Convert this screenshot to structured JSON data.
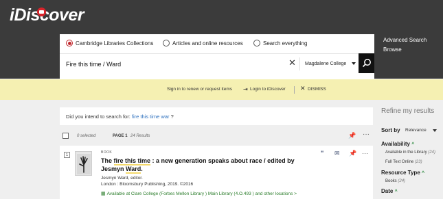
{
  "header": {
    "logo": "iDiscover",
    "links": [
      "Advanced Search",
      "Browse"
    ]
  },
  "search": {
    "scopes": [
      {
        "label": "Cambridge Libraries Collections",
        "checked": true
      },
      {
        "label": "Articles and online resources",
        "checked": false
      },
      {
        "label": "Search everything",
        "checked": false
      }
    ],
    "query": "Fire this time / Ward",
    "library": "Magdalene College"
  },
  "banner": {
    "text": "Sign in to renew or request items",
    "login": "Login to iDiscover",
    "dismiss": "DISMISS"
  },
  "did_you_mean": {
    "prefix": "Did you intend to search for:",
    "suggestion": "fire this time war",
    "suffix": "?"
  },
  "results_bar": {
    "selected": "0 selected",
    "page": "PAGE 1",
    "count": "24 Results"
  },
  "result": {
    "number": "1",
    "type": "BOOK",
    "title_pre": "The ",
    "title_hl1": "fire this time",
    "title_mid": " : a new generation speaks about race / edited by Jesmyn ",
    "title_hl2": "Ward",
    "title_post": ".",
    "author": "Jesmyn Ward, editor.",
    "publisher": "London : Bloomsbury Publishing, 2019. ©2016",
    "availability": "Available at Clare College (Forbes Mellon Library )  Main Library (4.O.493 ) and other locations  >"
  },
  "facets": {
    "title": "Refine my results",
    "sort_label": "Sort by",
    "sort_value": "Relevance",
    "groups": [
      {
        "name": "Availability",
        "items": [
          {
            "label": "Available in the Library",
            "count": "(24)"
          },
          {
            "label": "Full Text Online",
            "count": "(23)"
          }
        ]
      },
      {
        "name": "Resource Type",
        "items": [
          {
            "label": "Books",
            "count": "(24)"
          }
        ]
      },
      {
        "name": "Date",
        "items": []
      }
    ]
  },
  "colors": {
    "header_bg": "#3b3b3b",
    "banner_bg": "#f5f0b2",
    "accent_red": "#c0282d",
    "link_blue": "#2a6ebd",
    "available_green": "#2b7d2b"
  }
}
